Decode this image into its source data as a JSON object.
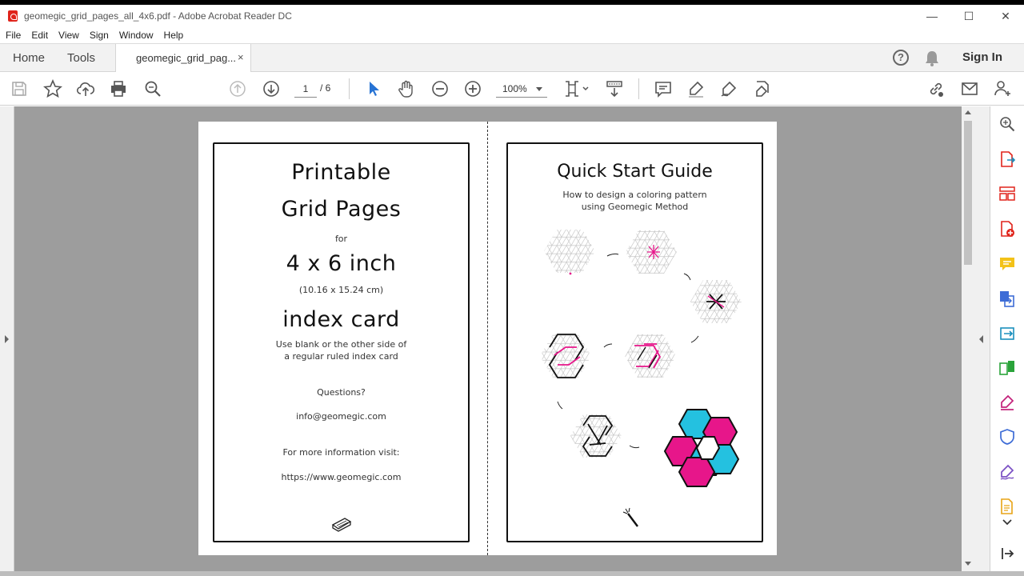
{
  "window": {
    "title": "geomegic_grid_pages_all_4x6.pdf - Adobe Acrobat Reader DC",
    "controls": [
      "—",
      "☐",
      "✕"
    ]
  },
  "menu": [
    "File",
    "Edit",
    "View",
    "Sign",
    "Window",
    "Help"
  ],
  "tabs": {
    "home": "Home",
    "tools": "Tools",
    "document": "geomegic_grid_pag...",
    "close": "×",
    "help": "?",
    "signin": "Sign In"
  },
  "toolbar": {
    "page_current": "1",
    "page_total": "/ 6",
    "zoom": "100%"
  },
  "left_card": {
    "title1": "Printable",
    "title2": "Grid Pages",
    "for": "for",
    "size": "4 x 6 inch",
    "metric": "(10.16 x 15.24 cm)",
    "card": "index card",
    "use1": "Use blank or the other side of",
    "use2": "a regular ruled index card",
    "questions": "Questions?",
    "email": "info@geomegic.com",
    "more": "For more information visit:",
    "url": "https://www.geomegic.com"
  },
  "right_card": {
    "title": "Quick Start Guide",
    "sub1": "How to design a coloring pattern",
    "sub2": "using Geomegic Method"
  },
  "colors": {
    "pink": "#e7168a",
    "cyan": "#24c1e0",
    "grid": "#c8c8c8"
  }
}
